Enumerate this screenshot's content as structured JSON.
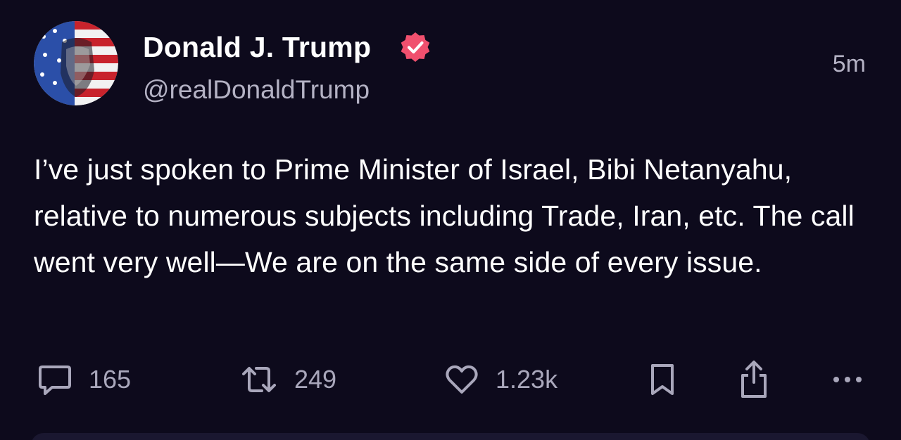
{
  "post": {
    "display_name": "Donald J. Trump",
    "handle": "@realDonaldTrump",
    "timestamp": "5m",
    "text": "I’ve just spoken to Prime Minister of Israel, Bibi Netanyahu, relative to numerous subjects including Trade, Iran, etc. The call went very well—We are on the same side of every issue."
  },
  "actions": {
    "replies": "165",
    "reposts": "249",
    "likes": "1.23k"
  },
  "icons": {
    "avatar": "avatar-flag-portrait",
    "verified": "verified-badge-icon",
    "reply": "comment-icon",
    "repost": "repost-icon",
    "like": "heart-icon",
    "bookmark": "bookmark-icon",
    "share": "share-icon",
    "more": "more-icon"
  },
  "colors": {
    "background": "#0d0a1c",
    "verified_badge": "#f0506e",
    "secondary_text": "#b4b2c4"
  }
}
